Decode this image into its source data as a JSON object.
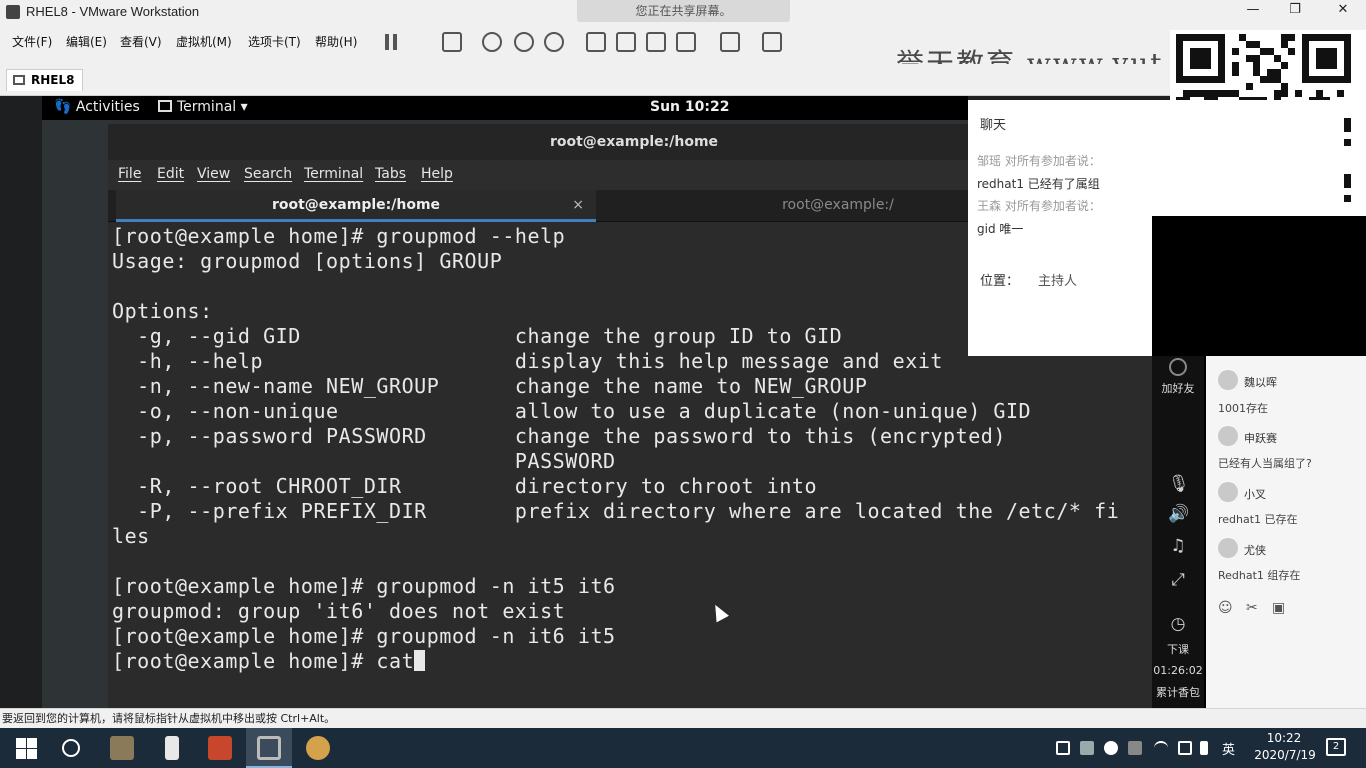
{
  "vmware": {
    "title": "RHEL8 - VMware Workstation",
    "share_banner": "您正在共享屏幕。",
    "menu": [
      "文件(F)",
      "编辑(E)",
      "查看(V)",
      "虚拟机(M)",
      "选项卡(T)",
      "帮助(H)"
    ],
    "tab": "RHEL8",
    "watermark": "誉天教育 www.yut",
    "status": "要返回到您的计算机，请将鼠标指针从虚拟机中移出或按 Ctrl+Alt。",
    "controls": {
      "minimize": "—",
      "restore": "❐",
      "close": "✕"
    }
  },
  "gnome": {
    "activities": "Activities",
    "app_menu": "Terminal ▾",
    "clock": "Sun 10:22"
  },
  "terminal": {
    "window_title": "root@example:/home",
    "menu": [
      "File",
      "Edit",
      "View",
      "Search",
      "Terminal",
      "Tabs",
      "Help"
    ],
    "tabs": [
      {
        "label": "root@example:/home",
        "active": true
      },
      {
        "label": "root@example:/",
        "active": false
      }
    ],
    "tab_close": "×",
    "lines": [
      "[root@example home]# groupmod --help",
      "Usage: groupmod [options] GROUP",
      "",
      "Options:",
      "  -g, --gid GID                 change the group ID to GID",
      "  -h, --help                    display this help message and exit",
      "  -n, --new-name NEW_GROUP      change the name to NEW_GROUP",
      "  -o, --non-unique              allow to use a duplicate (non-unique) GID",
      "  -p, --password PASSWORD       change the password to this (encrypted)",
      "                                PASSWORD",
      "  -R, --root CHROOT_DIR         directory to chroot into",
      "  -P, --prefix PREFIX_DIR       prefix directory where are located the /etc/* fi",
      "les",
      "",
      "[root@example home]# groupmod -n it5 it6",
      "groupmod: group 'it6' does not exist",
      "[root@example home]# groupmod -n it6 it5"
    ],
    "prompt_line": "[root@example home]# cat"
  },
  "chat": {
    "title": "聊天",
    "messages": [
      {
        "text": "邹瑶 对所有参加者说：",
        "sys": true
      },
      {
        "text": "redhat1 已经有了属组",
        "sys": false
      },
      {
        "text": "王森 对所有参加者说：",
        "sys": true
      },
      {
        "text": "gid 唯一",
        "sys": false
      }
    ],
    "position_label": "位置：",
    "position_value": "主持人",
    "chevron": "⌄"
  },
  "side": {
    "follow": "加好友",
    "class_end": "下课",
    "timer": "01:26:02",
    "gifts": "累计香包",
    "icons": [
      "microphone-icon",
      "speaker-icon",
      "music-icon",
      "fullscreen-icon",
      "clock-icon"
    ],
    "glyphs": {
      "mic": "🎙",
      "speaker": "🔊",
      "music": "♫",
      "fullscreen": "⤢",
      "clock": "◷",
      "emoji": "☺",
      "scissors": "✂",
      "image": "▣"
    },
    "comments": [
      {
        "name": "魏以晖",
        "text": "1001存在"
      },
      {
        "name": "申跃赛",
        "text": "已经有人当属组了?"
      },
      {
        "name": "小叉",
        "text": "redhat1 已存在"
      },
      {
        "name": "尤侠",
        "text": "Redhat1 组存在"
      }
    ]
  },
  "taskbar": {
    "ime": "英",
    "time": "10:22",
    "date": "2020/7/19",
    "notifications": "2"
  },
  "colors": {
    "terminal_bg": "#2b2b2b",
    "terminal_fg": "#e8e8e8",
    "tab_accent": "#3f7fc2",
    "taskbar": "#1c2b3a"
  }
}
